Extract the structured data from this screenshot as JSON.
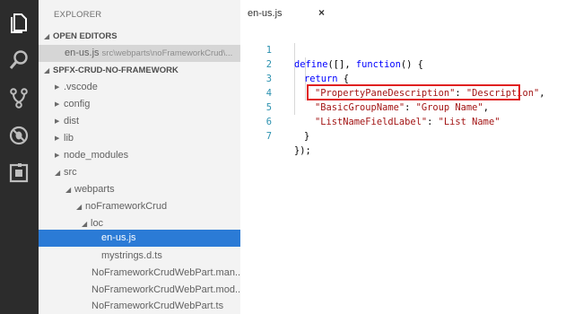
{
  "sidebar": {
    "title": "EXPLORER",
    "open_editors": {
      "label": "OPEN EDITORS",
      "items": [
        {
          "name": "en-us.js",
          "path": "src\\webparts\\noFrameworkCrud\\..."
        }
      ]
    },
    "project": {
      "label": "SPFX-CRUD-NO-FRAMEWORK"
    },
    "tree": [
      {
        "name": ".vscode",
        "expanded": false
      },
      {
        "name": "config",
        "expanded": false
      },
      {
        "name": "dist",
        "expanded": false
      },
      {
        "name": "lib",
        "expanded": false
      },
      {
        "name": "node_modules",
        "expanded": false
      },
      {
        "name": "src",
        "expanded": true
      },
      {
        "name": "webparts",
        "expanded": true
      },
      {
        "name": "noFrameworkCrud",
        "expanded": true
      },
      {
        "name": "loc",
        "expanded": true
      },
      {
        "name": "en-us.js",
        "selected": true
      },
      {
        "name": "mystrings.d.ts"
      },
      {
        "name": "NoFrameworkCrudWebPart.man..."
      },
      {
        "name": "NoFrameworkCrudWebPart.mod..."
      },
      {
        "name": "NoFrameworkCrudWebPart.ts"
      }
    ]
  },
  "editor": {
    "tab": {
      "label": "en-us.js",
      "close": "×"
    },
    "line_numbers": [
      "1",
      "2",
      "3",
      "4",
      "5",
      "6",
      "7"
    ],
    "code": {
      "l1": {
        "kw_define": "define",
        "p1": "([], ",
        "kw_function": "function",
        "p2": "() {"
      },
      "l2": {
        "kw_return": "return",
        "p": " {"
      },
      "l3": {
        "key": "\"PropertyPaneDescription\"",
        "sep": ": ",
        "val": "\"Description\"",
        "end": ","
      },
      "l4": {
        "key": "\"BasicGroupName\"",
        "sep": ": ",
        "val": "\"Group Name\"",
        "end": ","
      },
      "l5": {
        "key": "\"ListNameFieldLabel\"",
        "sep": ": ",
        "val": "\"List Name\""
      },
      "l6": {
        "p": "}"
      },
      "l7": {
        "p": "});"
      }
    }
  },
  "activity_icons": [
    "files-icon",
    "search-icon",
    "source-control-icon",
    "debug-icon",
    "extensions-icon"
  ],
  "colors": {
    "activity_bar": "#2c2c2c",
    "sidebar": "#f3f3f3",
    "selection": "#2b7bd6",
    "keyword": "#0000ff",
    "string": "#a31515",
    "line_number": "#2b91af",
    "highlight": "#e02020"
  }
}
